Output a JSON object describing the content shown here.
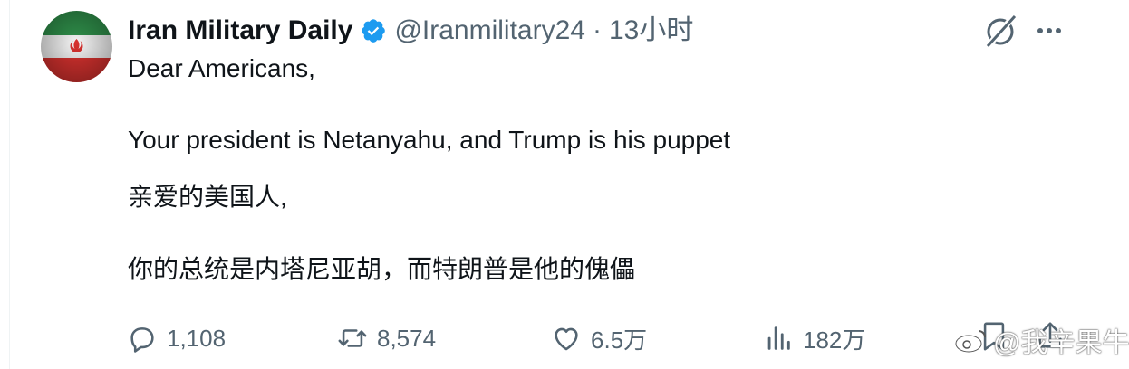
{
  "tweet": {
    "author": {
      "display_name": "Iran Military Daily",
      "handle": "@Iranmilitary24",
      "verified_icon": "verified-badge-icon",
      "avatar_icon": "iran-flag-avatar"
    },
    "separator": "·",
    "time": "13小时",
    "text_lines": [
      "Dear Americans,",
      "Your president is Netanyahu, and Trump is his puppet",
      "亲爱的美国人,",
      "你的总统是内塔尼亚胡，而特朗普是他的傀儡"
    ],
    "actions": {
      "reply_count": "1,108",
      "retweet_count": "8,574",
      "like_count": "6.5万",
      "view_count": "182万"
    }
  },
  "watermark": {
    "text": "@我辛果牛"
  },
  "colors": {
    "text_primary": "#0f1419",
    "text_secondary": "#536471",
    "verified_blue": "#1d9bf0"
  }
}
